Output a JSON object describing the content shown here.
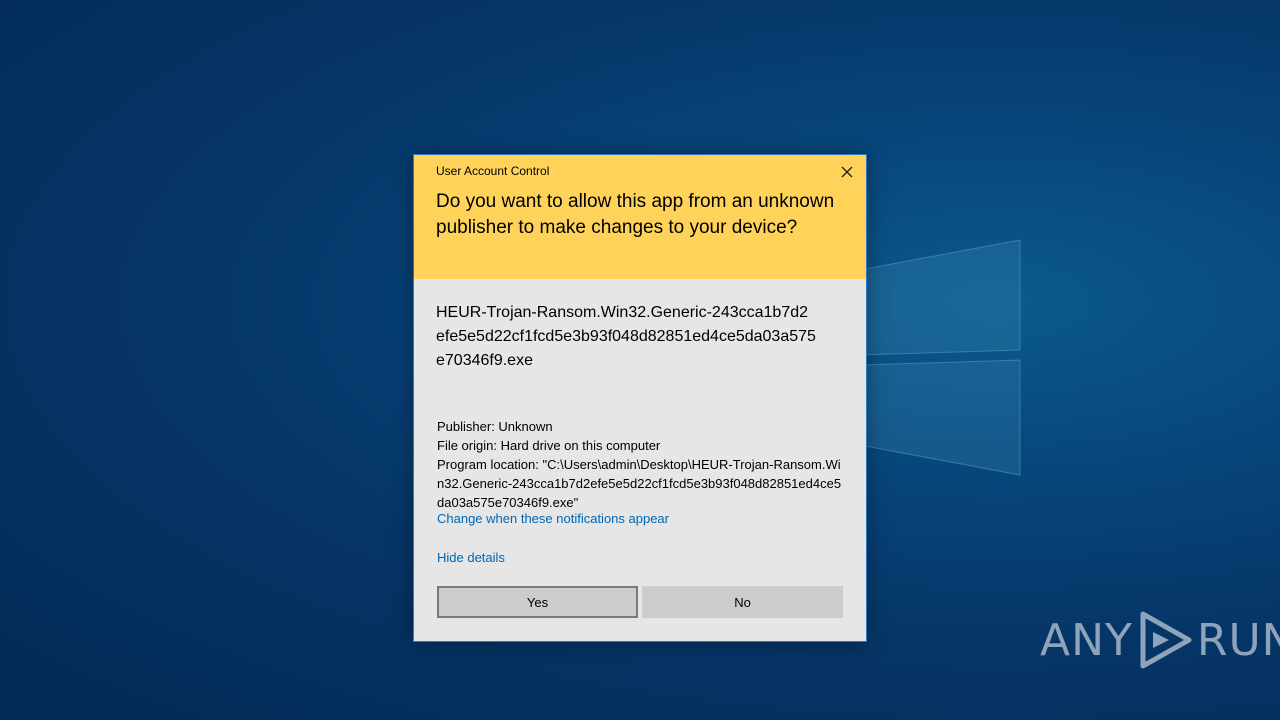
{
  "dialog": {
    "title": "User Account Control",
    "question": "Do you want to allow this app from an unknown publisher to make changes to your device?",
    "app_name": "HEUR-Trojan-Ransom.Win32.Generic-243cca1b7d2efe5e5d22cf1fcd5e3b93f048d82851ed4ce5da03a575e70346f9.exe",
    "publisher": "Publisher: Unknown",
    "file_origin": "File origin: Hard drive on this computer",
    "program_location": "Program location: \"C:\\Users\\admin\\Desktop\\HEUR-Trojan-Ransom.Win32.Generic-243cca1b7d2efe5e5d22cf1fcd5e3b93f048d82851ed4ce5da03a575e70346f9.exe\"",
    "change_link": "Change when these notifications appear",
    "hide_details": "Hide details",
    "yes_label": "Yes",
    "no_label": "No",
    "close_icon": "close-icon",
    "header_color": "#ffd25a",
    "link_color": "#0066b4"
  },
  "watermark": {
    "left_text": "ANY",
    "right_text": "RUN",
    "icon": "play-icon"
  }
}
